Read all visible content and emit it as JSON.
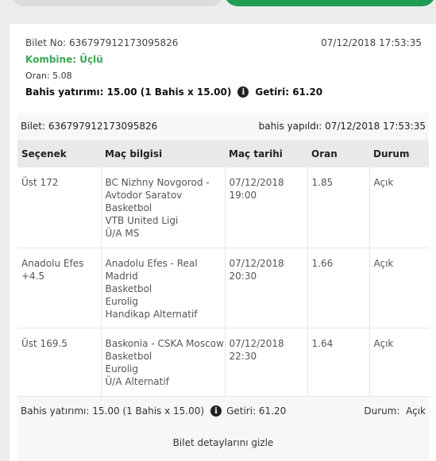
{
  "summary": {
    "ticket_id": "Bilet No: 636797912173095826",
    "date": "07/12/2018 17:53:35",
    "type": "Kombine: Üçlü",
    "odds": "Oran: 5.08",
    "stake": "Bahis yatırımı: 15.00 (1 Bahis x 15.00)",
    "return": "Getiri: 61.20"
  },
  "detail": {
    "ticket_id": "Bilet: 636797912173095826",
    "placed": "bahis yapıldı: 07/12/2018 17:53:35",
    "columns": [
      "Seçenek",
      "Maç bilgisi",
      "Maç tarihi",
      "Oran",
      "Durum"
    ],
    "rows": [
      {
        "selection": "Üst 172",
        "match": [
          "BC Nizhny Novgorod -",
          "Avtodor Saratov",
          "Basketbol",
          "VTB United Ligi",
          "Ü/A MS"
        ],
        "date": [
          "07/12/2018",
          "19:00"
        ],
        "odds": "1.85",
        "status": "Açık"
      },
      {
        "selection": "Anadolu Efes +4.5",
        "match": [
          "Anadolu Efes - Real",
          "Madrid",
          "Basketbol",
          "Eurolig",
          "Handikap Alternatif"
        ],
        "date": [
          "07/12/2018",
          "20:30"
        ],
        "odds": "1.66",
        "status": "Açık"
      },
      {
        "selection": "Üst 169.5",
        "match": [
          "Baskonia - CSKA Moscow",
          "Basketbol",
          "Eurolig",
          "Ü/A Alternatif"
        ],
        "date": [
          "07/12/2018",
          "22:30"
        ],
        "odds": "1.64",
        "status": "Açık"
      }
    ],
    "footer_stake": "Bahis yatırımı: 15.00 (1 Bahis x 15.00)",
    "footer_return": "Getiri: 61.20",
    "footer_status": "Durum:  Açık"
  },
  "hide_details": "Bilet detaylarını gizle",
  "icons": {
    "info": "info-icon"
  },
  "colors": {
    "accent_green": "#3aa757",
    "tab_green": "#1f9d55"
  }
}
